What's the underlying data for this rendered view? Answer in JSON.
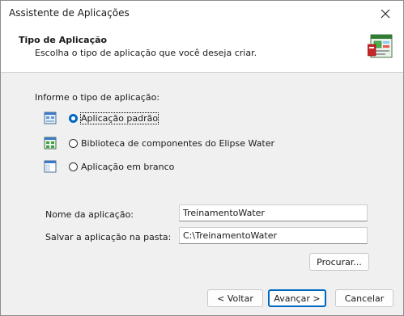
{
  "window": {
    "title": "Assistente de Aplicações"
  },
  "header": {
    "title": "Tipo de Aplicação",
    "subtitle": "Escolha o tipo de aplicação que você deseja criar."
  },
  "app_type": {
    "prompt": "Informe o tipo de aplicação:",
    "options": [
      {
        "label": "Aplicação padrão",
        "icon": "standard-app-icon",
        "selected": true
      },
      {
        "label": "Biblioteca de componentes do Elipse Water",
        "icon": "component-library-icon",
        "selected": false
      },
      {
        "label": "Aplicação em branco",
        "icon": "blank-app-icon",
        "selected": false
      }
    ]
  },
  "fields": {
    "name_label": "Nome da aplicação:",
    "name_value": "TreinamentoWater",
    "folder_label": "Salvar a aplicação na pasta:",
    "folder_value": "C:\\TreinamentoWater"
  },
  "buttons": {
    "browse": "Procurar...",
    "back": "< Voltar",
    "next": "Avançar >",
    "cancel": "Cancelar"
  },
  "colors": {
    "accent": "#0067c0"
  }
}
